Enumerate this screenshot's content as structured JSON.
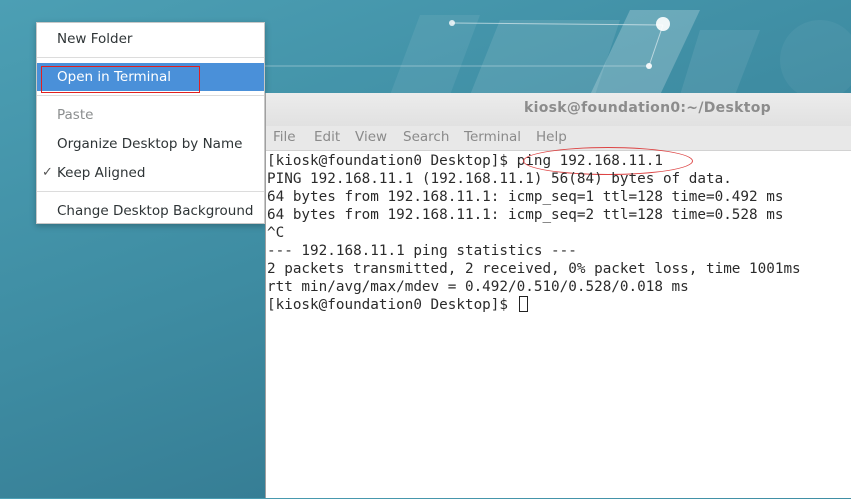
{
  "context_menu": {
    "items": [
      {
        "label": "New Folder"
      },
      {
        "label": "Open in Terminal"
      },
      {
        "label": "Paste"
      },
      {
        "label": "Organize Desktop by Name"
      },
      {
        "label": "Keep Aligned",
        "checked": true
      },
      {
        "label": "Change Desktop Background"
      }
    ],
    "check_glyph": "✓"
  },
  "terminal": {
    "title": "kiosk@foundation0:~/Desktop",
    "menu": [
      "File",
      "Edit",
      "View",
      "Search",
      "Terminal",
      "Help"
    ],
    "prompt": "[kiosk@foundation0 Desktop]$ ",
    "command": "ping 192.168.11.1",
    "output": [
      "PING 192.168.11.1 (192.168.11.1) 56(84) bytes of data.",
      "64 bytes from 192.168.11.1: icmp_seq=1 ttl=128 time=0.492 ms",
      "64 bytes from 192.168.11.1: icmp_seq=2 ttl=128 time=0.528 ms",
      "^C",
      "--- 192.168.11.1 ping statistics ---",
      "2 packets transmitted, 2 received, 0% packet loss, time 1001ms",
      "rtt min/avg/max/mdev = 0.492/0.510/0.528/0.018 ms"
    ],
    "final_prompt": "[kiosk@foundation0 Desktop]$ "
  },
  "colors": {
    "desktop": "#3e8ca2",
    "menu_highlight": "#4a90d9",
    "annotation": "#e02020"
  }
}
